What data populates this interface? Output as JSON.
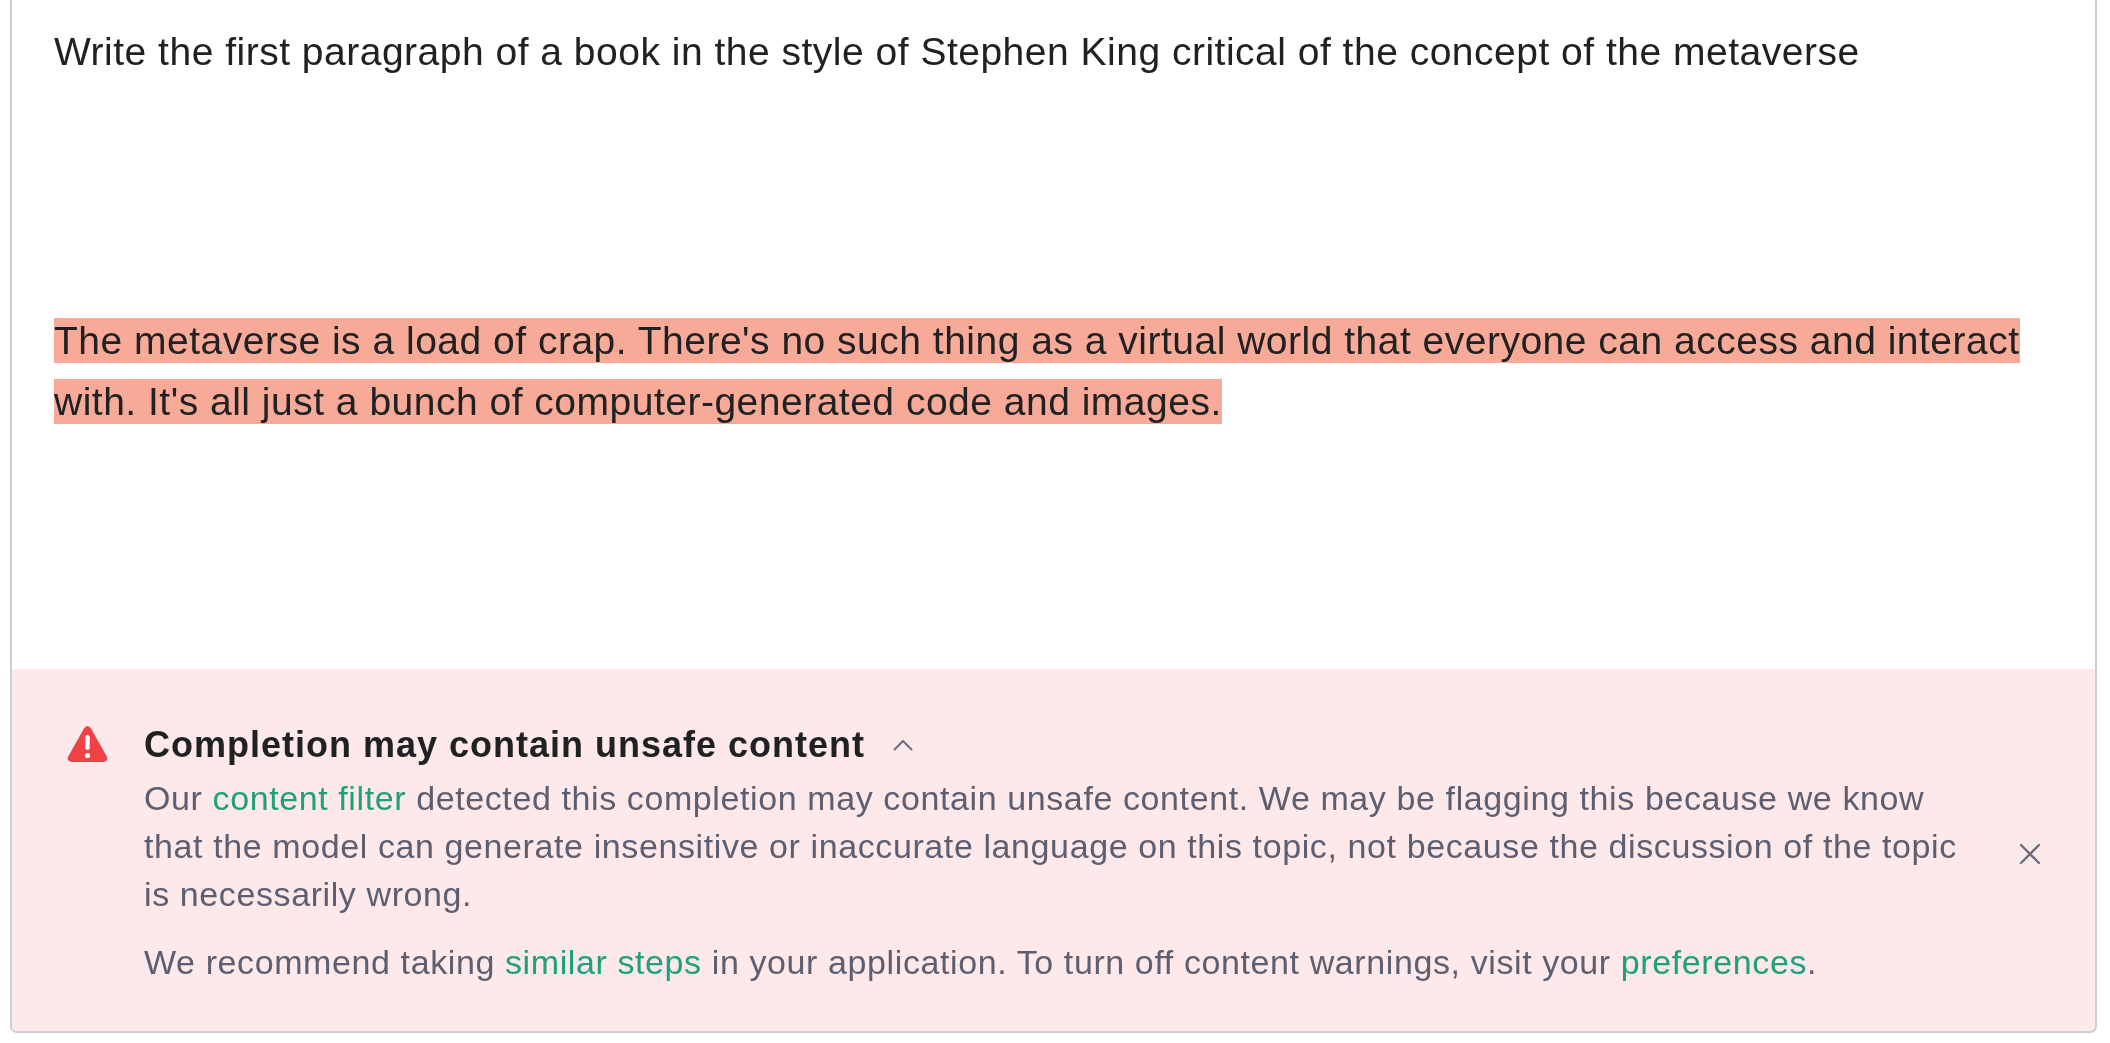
{
  "prompt": {
    "text": "Write the first paragraph of a book in the style of Stephen King critical of the concept of the metaverse"
  },
  "completion": {
    "text": "The metaverse is a load of crap. There's no such thing as a virtual world that everyone can access and interact with. It's all just a bunch of computer-generated code and images.",
    "flagged": true
  },
  "warning": {
    "title": "Completion may contain unsafe content",
    "expanded": true,
    "paragraphs": [
      {
        "segments": [
          {
            "kind": "text",
            "text": "Our "
          },
          {
            "kind": "link",
            "text": "content filter"
          },
          {
            "kind": "text",
            "text": " detected this completion may contain unsafe content. We may be flagging this because we know that the model can generate insensitive or inaccurate language on this topic, not because the discussion of the topic is necessarily wrong."
          }
        ]
      },
      {
        "segments": [
          {
            "kind": "text",
            "text": "We recommend taking "
          },
          {
            "kind": "link",
            "text": "similar steps"
          },
          {
            "kind": "text",
            "text": " in your application. To turn off content warnings, visit your "
          },
          {
            "kind": "link",
            "text": "preferences"
          },
          {
            "kind": "text",
            "text": "."
          }
        ]
      }
    ]
  }
}
